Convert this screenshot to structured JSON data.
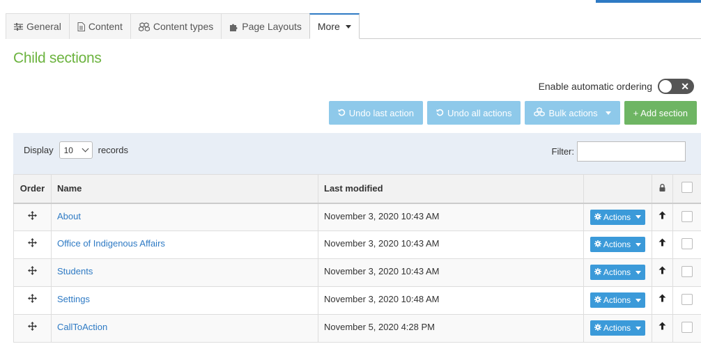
{
  "tabs": [
    {
      "label": "General",
      "icon": "sliders-icon"
    },
    {
      "label": "Content",
      "icon": "document-icon"
    },
    {
      "label": "Content types",
      "icon": "cubes-icon"
    },
    {
      "label": "Page Layouts",
      "icon": "puzzle-icon"
    },
    {
      "label": "More",
      "icon": "caret-down-icon"
    }
  ],
  "section_title": "Child sections",
  "auto_ordering": {
    "label": "Enable automatic ordering",
    "enabled": false
  },
  "toolbar": {
    "undo_last": "Undo last action",
    "undo_all": "Undo all actions",
    "bulk": "Bulk actions",
    "add": "+ Add section"
  },
  "listing": {
    "display_label": "Display",
    "display_value": "10",
    "records_label": "records",
    "filter_label": "Filter:"
  },
  "table": {
    "headers": {
      "order": "Order",
      "name": "Name",
      "modified": "Last modified"
    },
    "action_label": "Actions",
    "rows": [
      {
        "name": "About",
        "modified": "November 3, 2020 10:43 AM"
      },
      {
        "name": "Office of Indigenous Affairs",
        "modified": "November 3, 2020 10:43 AM"
      },
      {
        "name": "Students",
        "modified": "November 3, 2020 10:43 AM"
      },
      {
        "name": "Settings",
        "modified": "November 3, 2020 10:48 AM"
      },
      {
        "name": "CallToAction",
        "modified": "November 5, 2020 4:28 PM"
      }
    ]
  },
  "colors": {
    "accent": "#2e7ac4",
    "title_green": "#6cb33f",
    "add_green": "#6eb563",
    "light_blue": "#8ec9ea"
  }
}
